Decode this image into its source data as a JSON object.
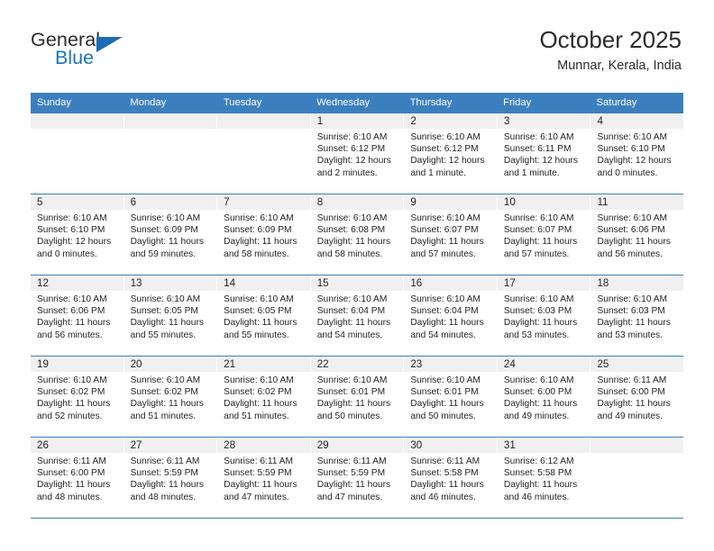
{
  "logo": {
    "word1": "General",
    "word2": "Blue",
    "triangle_color": "#1b6cb0",
    "blue_color": "#1b75bb"
  },
  "header": {
    "title": "October 2025",
    "subtitle": "Munnar, Kerala, India"
  },
  "theme": {
    "header_blue": "#3c7fbe",
    "daynum_band": "#f0f0f0",
    "text": "#231f20"
  },
  "calendar": {
    "day_headers": [
      "Sunday",
      "Monday",
      "Tuesday",
      "Wednesday",
      "Thursday",
      "Friday",
      "Saturday"
    ],
    "weeks": [
      [
        {
          "day": "",
          "empty": true
        },
        {
          "day": "",
          "empty": true
        },
        {
          "day": "",
          "empty": true
        },
        {
          "day": "1",
          "sunrise": "Sunrise: 6:10 AM",
          "sunset": "Sunset: 6:12 PM",
          "daylight1": "Daylight: 12 hours",
          "daylight2": "and 2 minutes."
        },
        {
          "day": "2",
          "sunrise": "Sunrise: 6:10 AM",
          "sunset": "Sunset: 6:12 PM",
          "daylight1": "Daylight: 12 hours",
          "daylight2": "and 1 minute."
        },
        {
          "day": "3",
          "sunrise": "Sunrise: 6:10 AM",
          "sunset": "Sunset: 6:11 PM",
          "daylight1": "Daylight: 12 hours",
          "daylight2": "and 1 minute."
        },
        {
          "day": "4",
          "sunrise": "Sunrise: 6:10 AM",
          "sunset": "Sunset: 6:10 PM",
          "daylight1": "Daylight: 12 hours",
          "daylight2": "and 0 minutes."
        }
      ],
      [
        {
          "day": "5",
          "sunrise": "Sunrise: 6:10 AM",
          "sunset": "Sunset: 6:10 PM",
          "daylight1": "Daylight: 12 hours",
          "daylight2": "and 0 minutes."
        },
        {
          "day": "6",
          "sunrise": "Sunrise: 6:10 AM",
          "sunset": "Sunset: 6:09 PM",
          "daylight1": "Daylight: 11 hours",
          "daylight2": "and 59 minutes."
        },
        {
          "day": "7",
          "sunrise": "Sunrise: 6:10 AM",
          "sunset": "Sunset: 6:09 PM",
          "daylight1": "Daylight: 11 hours",
          "daylight2": "and 58 minutes."
        },
        {
          "day": "8",
          "sunrise": "Sunrise: 6:10 AM",
          "sunset": "Sunset: 6:08 PM",
          "daylight1": "Daylight: 11 hours",
          "daylight2": "and 58 minutes."
        },
        {
          "day": "9",
          "sunrise": "Sunrise: 6:10 AM",
          "sunset": "Sunset: 6:07 PM",
          "daylight1": "Daylight: 11 hours",
          "daylight2": "and 57 minutes."
        },
        {
          "day": "10",
          "sunrise": "Sunrise: 6:10 AM",
          "sunset": "Sunset: 6:07 PM",
          "daylight1": "Daylight: 11 hours",
          "daylight2": "and 57 minutes."
        },
        {
          "day": "11",
          "sunrise": "Sunrise: 6:10 AM",
          "sunset": "Sunset: 6:06 PM",
          "daylight1": "Daylight: 11 hours",
          "daylight2": "and 56 minutes."
        }
      ],
      [
        {
          "day": "12",
          "sunrise": "Sunrise: 6:10 AM",
          "sunset": "Sunset: 6:06 PM",
          "daylight1": "Daylight: 11 hours",
          "daylight2": "and 56 minutes."
        },
        {
          "day": "13",
          "sunrise": "Sunrise: 6:10 AM",
          "sunset": "Sunset: 6:05 PM",
          "daylight1": "Daylight: 11 hours",
          "daylight2": "and 55 minutes."
        },
        {
          "day": "14",
          "sunrise": "Sunrise: 6:10 AM",
          "sunset": "Sunset: 6:05 PM",
          "daylight1": "Daylight: 11 hours",
          "daylight2": "and 55 minutes."
        },
        {
          "day": "15",
          "sunrise": "Sunrise: 6:10 AM",
          "sunset": "Sunset: 6:04 PM",
          "daylight1": "Daylight: 11 hours",
          "daylight2": "and 54 minutes."
        },
        {
          "day": "16",
          "sunrise": "Sunrise: 6:10 AM",
          "sunset": "Sunset: 6:04 PM",
          "daylight1": "Daylight: 11 hours",
          "daylight2": "and 54 minutes."
        },
        {
          "day": "17",
          "sunrise": "Sunrise: 6:10 AM",
          "sunset": "Sunset: 6:03 PM",
          "daylight1": "Daylight: 11 hours",
          "daylight2": "and 53 minutes."
        },
        {
          "day": "18",
          "sunrise": "Sunrise: 6:10 AM",
          "sunset": "Sunset: 6:03 PM",
          "daylight1": "Daylight: 11 hours",
          "daylight2": "and 53 minutes."
        }
      ],
      [
        {
          "day": "19",
          "sunrise": "Sunrise: 6:10 AM",
          "sunset": "Sunset: 6:02 PM",
          "daylight1": "Daylight: 11 hours",
          "daylight2": "and 52 minutes."
        },
        {
          "day": "20",
          "sunrise": "Sunrise: 6:10 AM",
          "sunset": "Sunset: 6:02 PM",
          "daylight1": "Daylight: 11 hours",
          "daylight2": "and 51 minutes."
        },
        {
          "day": "21",
          "sunrise": "Sunrise: 6:10 AM",
          "sunset": "Sunset: 6:02 PM",
          "daylight1": "Daylight: 11 hours",
          "daylight2": "and 51 minutes."
        },
        {
          "day": "22",
          "sunrise": "Sunrise: 6:10 AM",
          "sunset": "Sunset: 6:01 PM",
          "daylight1": "Daylight: 11 hours",
          "daylight2": "and 50 minutes."
        },
        {
          "day": "23",
          "sunrise": "Sunrise: 6:10 AM",
          "sunset": "Sunset: 6:01 PM",
          "daylight1": "Daylight: 11 hours",
          "daylight2": "and 50 minutes."
        },
        {
          "day": "24",
          "sunrise": "Sunrise: 6:10 AM",
          "sunset": "Sunset: 6:00 PM",
          "daylight1": "Daylight: 11 hours",
          "daylight2": "and 49 minutes."
        },
        {
          "day": "25",
          "sunrise": "Sunrise: 6:11 AM",
          "sunset": "Sunset: 6:00 PM",
          "daylight1": "Daylight: 11 hours",
          "daylight2": "and 49 minutes."
        }
      ],
      [
        {
          "day": "26",
          "sunrise": "Sunrise: 6:11 AM",
          "sunset": "Sunset: 6:00 PM",
          "daylight1": "Daylight: 11 hours",
          "daylight2": "and 48 minutes."
        },
        {
          "day": "27",
          "sunrise": "Sunrise: 6:11 AM",
          "sunset": "Sunset: 5:59 PM",
          "daylight1": "Daylight: 11 hours",
          "daylight2": "and 48 minutes."
        },
        {
          "day": "28",
          "sunrise": "Sunrise: 6:11 AM",
          "sunset": "Sunset: 5:59 PM",
          "daylight1": "Daylight: 11 hours",
          "daylight2": "and 47 minutes."
        },
        {
          "day": "29",
          "sunrise": "Sunrise: 6:11 AM",
          "sunset": "Sunset: 5:59 PM",
          "daylight1": "Daylight: 11 hours",
          "daylight2": "and 47 minutes."
        },
        {
          "day": "30",
          "sunrise": "Sunrise: 6:11 AM",
          "sunset": "Sunset: 5:58 PM",
          "daylight1": "Daylight: 11 hours",
          "daylight2": "and 46 minutes."
        },
        {
          "day": "31",
          "sunrise": "Sunrise: 6:12 AM",
          "sunset": "Sunset: 5:58 PM",
          "daylight1": "Daylight: 11 hours",
          "daylight2": "and 46 minutes."
        },
        {
          "day": "",
          "empty": true
        }
      ]
    ]
  }
}
